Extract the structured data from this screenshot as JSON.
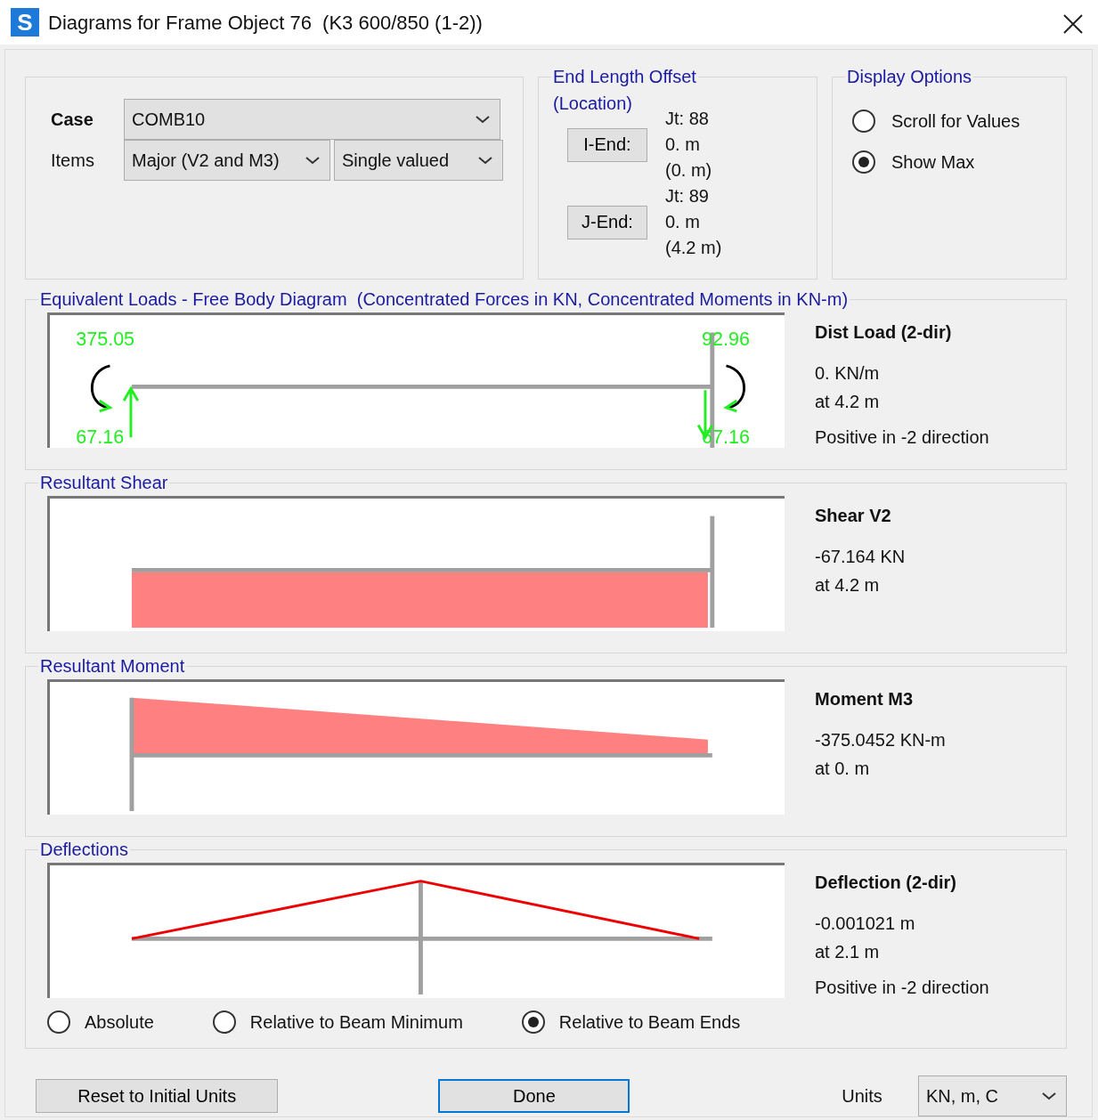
{
  "window": {
    "icon_letter": "S",
    "title": "Diagrams for Frame Object 76  (K3 600/850 (1-2))"
  },
  "case": {
    "label": "Case",
    "value": "COMB10"
  },
  "items": {
    "label": "Items",
    "values": [
      "Major (V2 and M3)",
      "Single valued"
    ]
  },
  "end_length_offset": {
    "title": "End Length Offset",
    "subtitle": "(Location)",
    "ends": [
      {
        "button": "I-End:",
        "joint": "Jt:  88",
        "offset": "0. m",
        "location": "(0. m)"
      },
      {
        "button": "J-End:",
        "joint": "Jt:  89",
        "offset": "0. m",
        "location": "(4.2 m)"
      }
    ]
  },
  "display_options": {
    "title": "Display Options",
    "options": [
      {
        "label": "Scroll for Values",
        "selected": false
      },
      {
        "label": "Show Max",
        "selected": true
      }
    ]
  },
  "panels": [
    {
      "kind": "loads",
      "title": "Equivalent Loads - Free Body Diagram  (Concentrated Forces in KN, Concentrated Moments in KN-m)",
      "values": {
        "left_moment": "375.05",
        "left_force": "67.16",
        "right_moment": "92.96",
        "right_force": "67.16"
      },
      "info_title": "Dist Load (2-dir)",
      "info": [
        "0. KN/m",
        "at 4.2 m",
        "Positive in -2 direction"
      ]
    },
    {
      "kind": "shear",
      "title": "Resultant Shear",
      "info_title": "Shear V2",
      "info": [
        "-67.164 KN",
        "at 4.2 m"
      ]
    },
    {
      "kind": "moment",
      "title": "Resultant Moment",
      "info_title": "Moment M3",
      "info": [
        "-375.0452 KN-m",
        "at 0. m"
      ]
    },
    {
      "kind": "deflection",
      "title": "Deflections",
      "info_title": "Deflection (2-dir)",
      "info": [
        "-0.001021 m",
        "at 2.1 m",
        "Positive in -2 direction"
      ],
      "modes": [
        {
          "label": "Absolute",
          "selected": false
        },
        {
          "label": "Relative to Beam Minimum",
          "selected": false
        },
        {
          "label": "Relative to Beam Ends",
          "selected": true
        }
      ]
    }
  ],
  "buttons": {
    "reset": "Reset to Initial Units",
    "done": "Done"
  },
  "units": {
    "label": "Units",
    "value": "KN, m, C"
  }
}
